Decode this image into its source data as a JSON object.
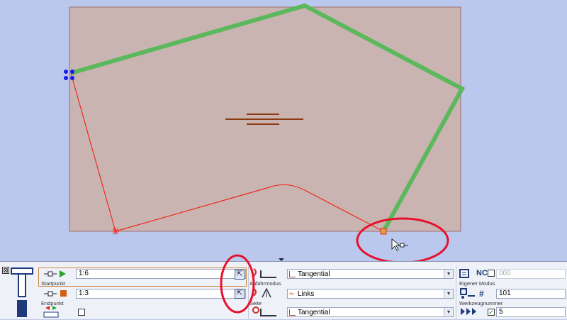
{
  "panel": {
    "close_label": "⊠",
    "startpoint": {
      "value": "1:6",
      "label": "Startpunkt"
    },
    "endpoint": {
      "value": "1:3",
      "label": "Endpunkt"
    },
    "approach": {
      "value": "Tangential",
      "label": "Anfahrmodus"
    },
    "side": {
      "value": "Links",
      "label": "Seite"
    },
    "third_mode": {
      "value": "Tangential"
    },
    "own_mode": {
      "title": "NC",
      "value": "000",
      "label": "Eigener Modus"
    },
    "tool_number": {
      "value": "101",
      "label": "Werkzeugnummer"
    },
    "count": {
      "value": "5"
    },
    "icons": {
      "toolbar": "tool-t-icon",
      "start": "start-point-play-icon",
      "end": "end-point-stop-icon",
      "pick": "pick-cursor-icon",
      "feed": "feed-arrows-icon"
    }
  },
  "colors": {
    "background": "#b9c8ec",
    "workpiece": "#c9b4b2",
    "contour": "#ee2a1a",
    "selected_path": "#5cb85c",
    "annotation_circle": "#e8112d"
  }
}
